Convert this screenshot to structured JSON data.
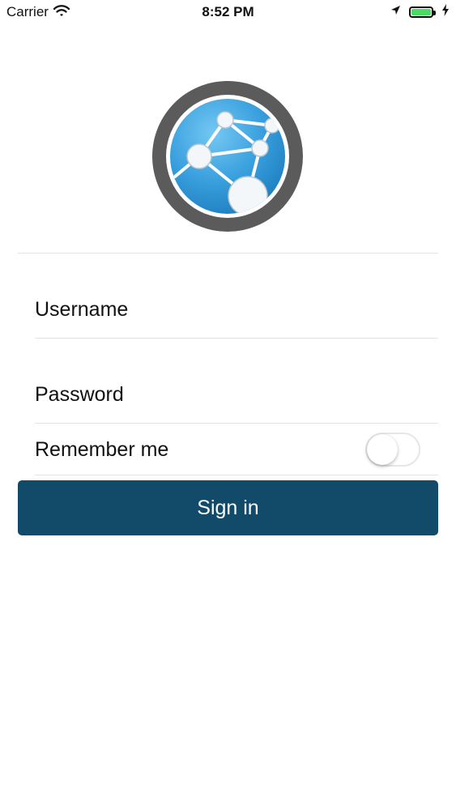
{
  "status_bar": {
    "carrier": "Carrier",
    "time": "8:52 PM",
    "icons": [
      "wifi-icon",
      "location-arrow-icon",
      "battery-icon",
      "charging-bolt-icon"
    ],
    "battery_color": "#4cd964"
  },
  "logo": {
    "icon": "network-globe-logo",
    "colors": {
      "ring": "#5b5b5b",
      "globe": "#3aa0de"
    }
  },
  "form": {
    "username_placeholder": "Username",
    "password_placeholder": "Password",
    "remember_label": "Remember me",
    "remember_enabled": false
  },
  "actions": {
    "sign_in_label": "Sign in",
    "sign_in_color": "#124a6a"
  }
}
